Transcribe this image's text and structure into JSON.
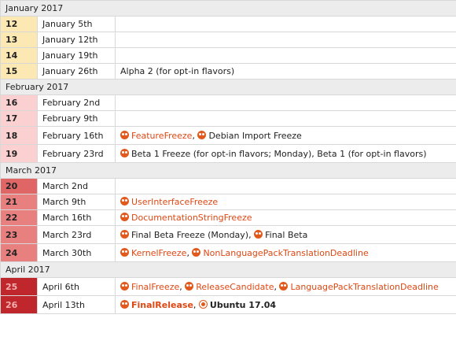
{
  "months": [
    {
      "label": "January 2017",
      "weeks": [
        {
          "week": "12",
          "date": "January 5th",
          "color": "#fce8b2",
          "text_color": "#222",
          "events": []
        },
        {
          "week": "13",
          "date": "January 12th",
          "color": "#fce8b2",
          "text_color": "#222",
          "events": []
        },
        {
          "week": "14",
          "date": "January 19th",
          "color": "#fce8b2",
          "text_color": "#222",
          "events": []
        },
        {
          "week": "15",
          "date": "January 26th",
          "color": "#fce8b2",
          "text_color": "#222",
          "events": [
            {
              "text": "Alpha 2 (for opt-in flavors)",
              "link": false,
              "icon": "",
              "bold": false
            }
          ]
        }
      ]
    },
    {
      "label": "February 2017",
      "weeks": [
        {
          "week": "16",
          "date": "February 2nd",
          "color": "#fbd0d0",
          "text_color": "#222",
          "events": []
        },
        {
          "week": "17",
          "date": "February 9th",
          "color": "#fbd0d0",
          "text_color": "#222",
          "events": []
        },
        {
          "week": "18",
          "date": "February 16th",
          "color": "#fbd0d0",
          "text_color": "#222",
          "events": [
            {
              "text": "FeatureFreeze",
              "link": true,
              "icon": "freeze-icon",
              "bold": false
            },
            {
              "text": ", ",
              "link": false,
              "icon": "",
              "bold": false
            },
            {
              "text": "Debian Import Freeze",
              "link": false,
              "icon": "freeze-icon",
              "bold": false
            }
          ]
        },
        {
          "week": "19",
          "date": "February 23rd",
          "color": "#fbd0d0",
          "text_color": "#222",
          "events": [
            {
              "text": "Beta 1 Freeze (for opt-in flavors; Monday), Beta 1 (for opt-in flavors)",
              "link": false,
              "icon": "freeze-icon",
              "bold": false
            }
          ]
        }
      ]
    },
    {
      "label": "March 2017",
      "weeks": [
        {
          "week": "20",
          "date": "March 2nd",
          "color": "#e06666",
          "text_color": "#222",
          "events": []
        },
        {
          "week": "21",
          "date": "March 9th",
          "color": "#e88080",
          "text_color": "#222",
          "events": [
            {
              "text": "UserInterfaceFreeze",
              "link": true,
              "icon": "freeze-icon",
              "bold": false
            }
          ]
        },
        {
          "week": "22",
          "date": "March 16th",
          "color": "#e88080",
          "text_color": "#222",
          "events": [
            {
              "text": "DocumentationStringFreeze",
              "link": true,
              "icon": "freeze-icon",
              "bold": false
            }
          ]
        },
        {
          "week": "23",
          "date": "March 23rd",
          "color": "#e88080",
          "text_color": "#222",
          "events": [
            {
              "text": "Final Beta Freeze (Monday)",
              "link": false,
              "icon": "freeze-icon",
              "bold": false
            },
            {
              "text": ", ",
              "link": false,
              "icon": "",
              "bold": false
            },
            {
              "text": "Final Beta",
              "link": false,
              "icon": "freeze-icon",
              "bold": false
            }
          ]
        },
        {
          "week": "24",
          "date": "March 30th",
          "color": "#e88080",
          "text_color": "#222",
          "events": [
            {
              "text": "KernelFreeze",
              "link": true,
              "icon": "freeze-icon",
              "bold": false
            },
            {
              "text": ", ",
              "link": false,
              "icon": "",
              "bold": false
            },
            {
              "text": "NonLanguagePackTranslationDeadline",
              "link": true,
              "icon": "freeze-icon",
              "bold": false
            }
          ]
        }
      ]
    },
    {
      "label": "April 2017",
      "weeks": [
        {
          "week": "25",
          "date": "April 6th",
          "color": "#c0272d",
          "text_color": "#f3b0b0",
          "events": [
            {
              "text": "FinalFreeze",
              "link": true,
              "icon": "freeze-icon",
              "bold": false
            },
            {
              "text": ", ",
              "link": false,
              "icon": "",
              "bold": false
            },
            {
              "text": "ReleaseCandidate",
              "link": true,
              "icon": "freeze-icon",
              "bold": false
            },
            {
              "text": ", ",
              "link": false,
              "icon": "",
              "bold": false
            },
            {
              "text": "LanguagePackTranslationDeadline",
              "link": true,
              "icon": "freeze-icon",
              "bold": false
            }
          ]
        },
        {
          "week": "26",
          "date": "April 13th",
          "color": "#c0272d",
          "text_color": "#f3b0b0",
          "events": [
            {
              "text": "FinalRelease",
              "link": true,
              "icon": "freeze-icon",
              "bold": true
            },
            {
              "text": ", ",
              "link": false,
              "icon": "",
              "bold": false
            },
            {
              "text": "Ubuntu 17.04",
              "link": false,
              "icon": "ubuntu-logo-icon",
              "bold": true
            }
          ]
        }
      ]
    }
  ]
}
